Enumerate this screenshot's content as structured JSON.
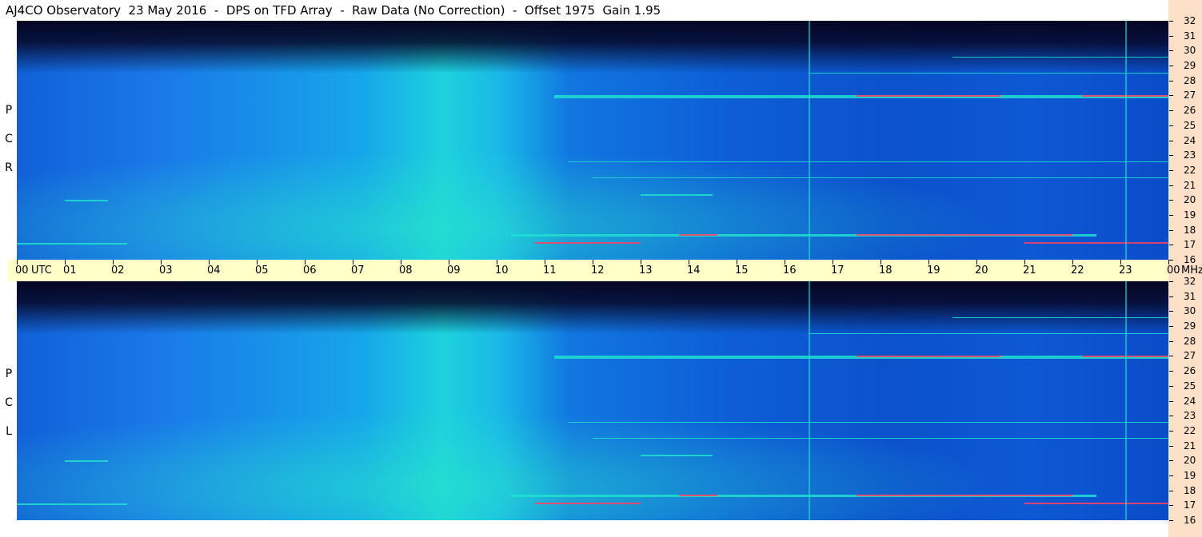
{
  "title": "AJ4CO Observatory  23 May 2016  -  DPS on TFD Array  -  Raw Data (No Correction)  -  Offset 1975  Gain 1.95",
  "panels": [
    {
      "polarization_letters": [
        "P",
        "C",
        "R"
      ]
    },
    {
      "polarization_letters": [
        "P",
        "C",
        "L"
      ]
    }
  ],
  "chart_data": {
    "type": "heatmap",
    "title": "AJ4CO Observatory  23 May 2016  -  DPS on TFD Array  -  Raw Data (No Correction)  -  Offset 1975  Gain 1.95",
    "x_axis": {
      "tick_labels": [
        "00",
        "UTC",
        "01",
        "02",
        "03",
        "04",
        "05",
        "06",
        "07",
        "08",
        "09",
        "10",
        "11",
        "12",
        "13",
        "14",
        "15",
        "16",
        "17",
        "18",
        "19",
        "20",
        "21",
        "22",
        "23",
        "00",
        "MHz"
      ],
      "hours": [
        0,
        1,
        2,
        3,
        4,
        5,
        6,
        7,
        8,
        9,
        10,
        11,
        12,
        13,
        14,
        15,
        16,
        17,
        18,
        19,
        20,
        21,
        22,
        23,
        24
      ],
      "unit_label": "UTC",
      "range": [
        0,
        24
      ]
    },
    "y_axis": {
      "tick_labels": [
        "32",
        "31",
        "30",
        "29",
        "28",
        "27",
        "26",
        "25",
        "24",
        "23",
        "22",
        "21",
        "20",
        "19",
        "18",
        "17",
        "16"
      ],
      "unit_label": "MHz",
      "range": [
        16,
        32
      ]
    },
    "series": [
      {
        "polarization": "RCP"
      },
      {
        "polarization": "LCP"
      }
    ],
    "colors": {
      "low": "#050523",
      "mid": "#1060d8",
      "high": "#20e0d0",
      "intense": "#ff4060"
    }
  }
}
